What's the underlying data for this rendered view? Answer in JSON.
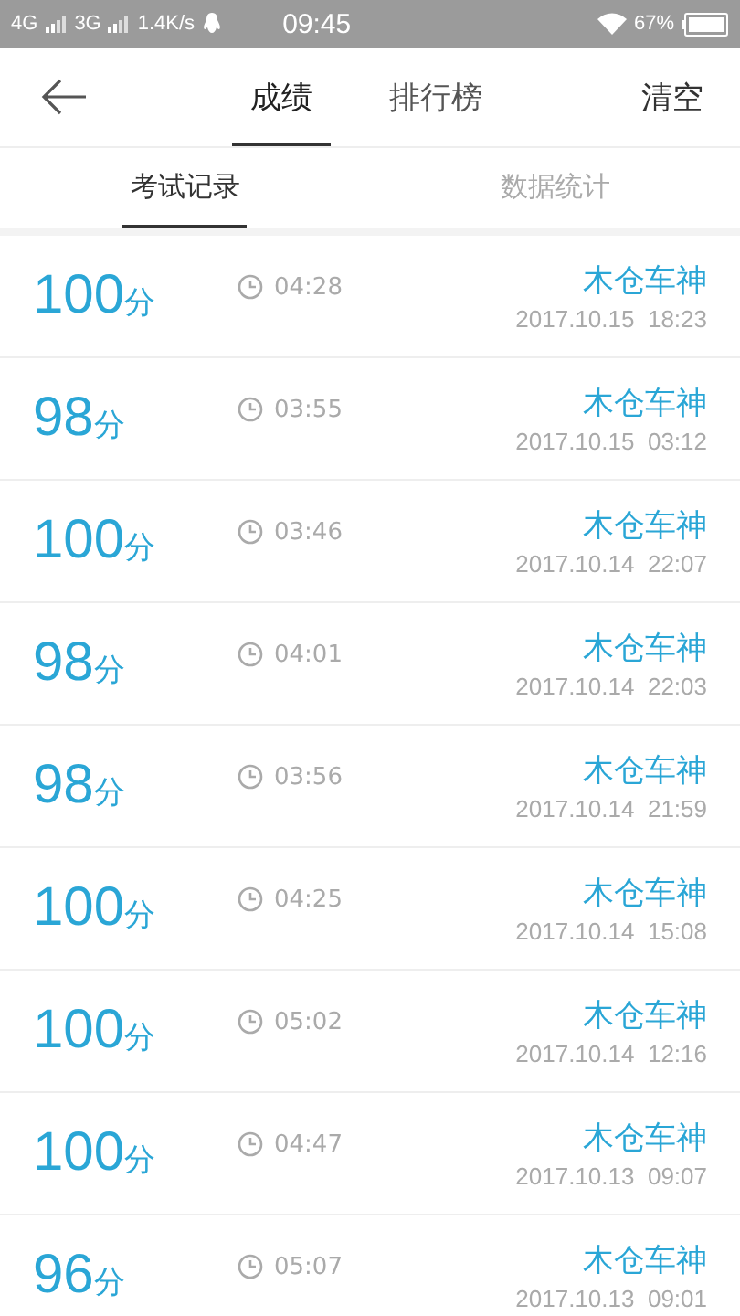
{
  "status_bar": {
    "network_1": "4G",
    "network_2": "3G",
    "speed": "1.4K/s",
    "time": "09:45",
    "battery": "67%"
  },
  "header": {
    "tabs": [
      {
        "label": "成绩",
        "selected": true
      },
      {
        "label": "排行榜",
        "selected": false
      }
    ],
    "action": "清空"
  },
  "subtabs": [
    {
      "label": "考试记录",
      "selected": true
    },
    {
      "label": "数据统计",
      "selected": false
    }
  ],
  "records": [
    {
      "score": "100",
      "unit": "分",
      "duration": "04:28",
      "name": "木仓车神",
      "date": "2017.10.15  18:23"
    },
    {
      "score": "98",
      "unit": "分",
      "duration": "03:55",
      "name": "木仓车神",
      "date": "2017.10.15  03:12"
    },
    {
      "score": "100",
      "unit": "分",
      "duration": "03:46",
      "name": "木仓车神",
      "date": "2017.10.14  22:07"
    },
    {
      "score": "98",
      "unit": "分",
      "duration": "04:01",
      "name": "木仓车神",
      "date": "2017.10.14  22:03"
    },
    {
      "score": "98",
      "unit": "分",
      "duration": "03:56",
      "name": "木仓车神",
      "date": "2017.10.14  21:59"
    },
    {
      "score": "100",
      "unit": "分",
      "duration": "04:25",
      "name": "木仓车神",
      "date": "2017.10.14  15:08"
    },
    {
      "score": "100",
      "unit": "分",
      "duration": "05:02",
      "name": "木仓车神",
      "date": "2017.10.14  12:16"
    },
    {
      "score": "100",
      "unit": "分",
      "duration": "04:47",
      "name": "木仓车神",
      "date": "2017.10.13  09:07"
    },
    {
      "score": "96",
      "unit": "分",
      "duration": "05:07",
      "name": "木仓车神",
      "date": "2017.10.13  09:01"
    }
  ]
}
